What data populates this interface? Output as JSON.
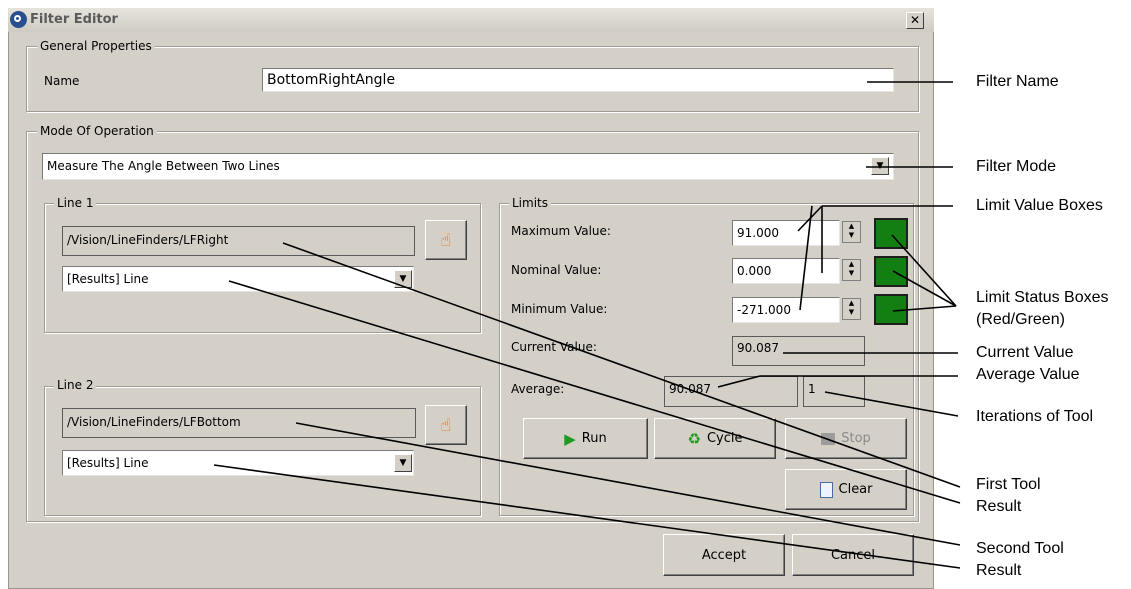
{
  "window": {
    "title": "Filter Editor",
    "close_glyph": "✕"
  },
  "general": {
    "legend": "General Properties",
    "name_label": "Name",
    "name_value": "BottomRightAngle"
  },
  "mode": {
    "legend": "Mode Of Operation",
    "selected": "Measure The Angle Between Two Lines"
  },
  "line1": {
    "legend": "Line 1",
    "path": "/Vision/LineFinders/LFRight",
    "result": "[Results] Line"
  },
  "line2": {
    "legend": "Line 2",
    "path": "/Vision/LineFinders/LFBottom",
    "result": "[Results] Line"
  },
  "limits": {
    "legend": "Limits",
    "max_label": "Maximum Value:",
    "max_value": "91.000",
    "nom_label": "Nominal Value:",
    "nom_value": "0.000",
    "min_label": "Minimum Value:",
    "min_value": "-271.000",
    "current_label": "Current Value:",
    "current_value": "90.087",
    "average_label": "Average:",
    "average_value": "90.087",
    "iterations": "1",
    "status_color": "#137f13"
  },
  "buttons": {
    "run": "Run",
    "cycle": "Cycle",
    "stop": "Stop",
    "clear": "Clear",
    "accept": "Accept",
    "cancel": "Cancel"
  },
  "icons": {
    "pick": "pointing-hand-icon",
    "run": "play-icon",
    "cycle": "recycle-icon",
    "stop": "stop-icon",
    "clear": "clipboard-icon"
  },
  "annotations": {
    "filter_name": "Filter Name",
    "filter_mode": "Filter Mode",
    "limit_value_boxes": "Limit Value Boxes",
    "limit_status_1": "Limit Status Boxes",
    "limit_status_2": "(Red/Green)",
    "current_value": "Current Value",
    "average_value": "Average Value",
    "iterations": "Iterations of Tool",
    "first_tool_1": "First Tool",
    "first_tool_2": "Result",
    "second_tool_1": "Second Tool",
    "second_tool_2": "Result"
  }
}
